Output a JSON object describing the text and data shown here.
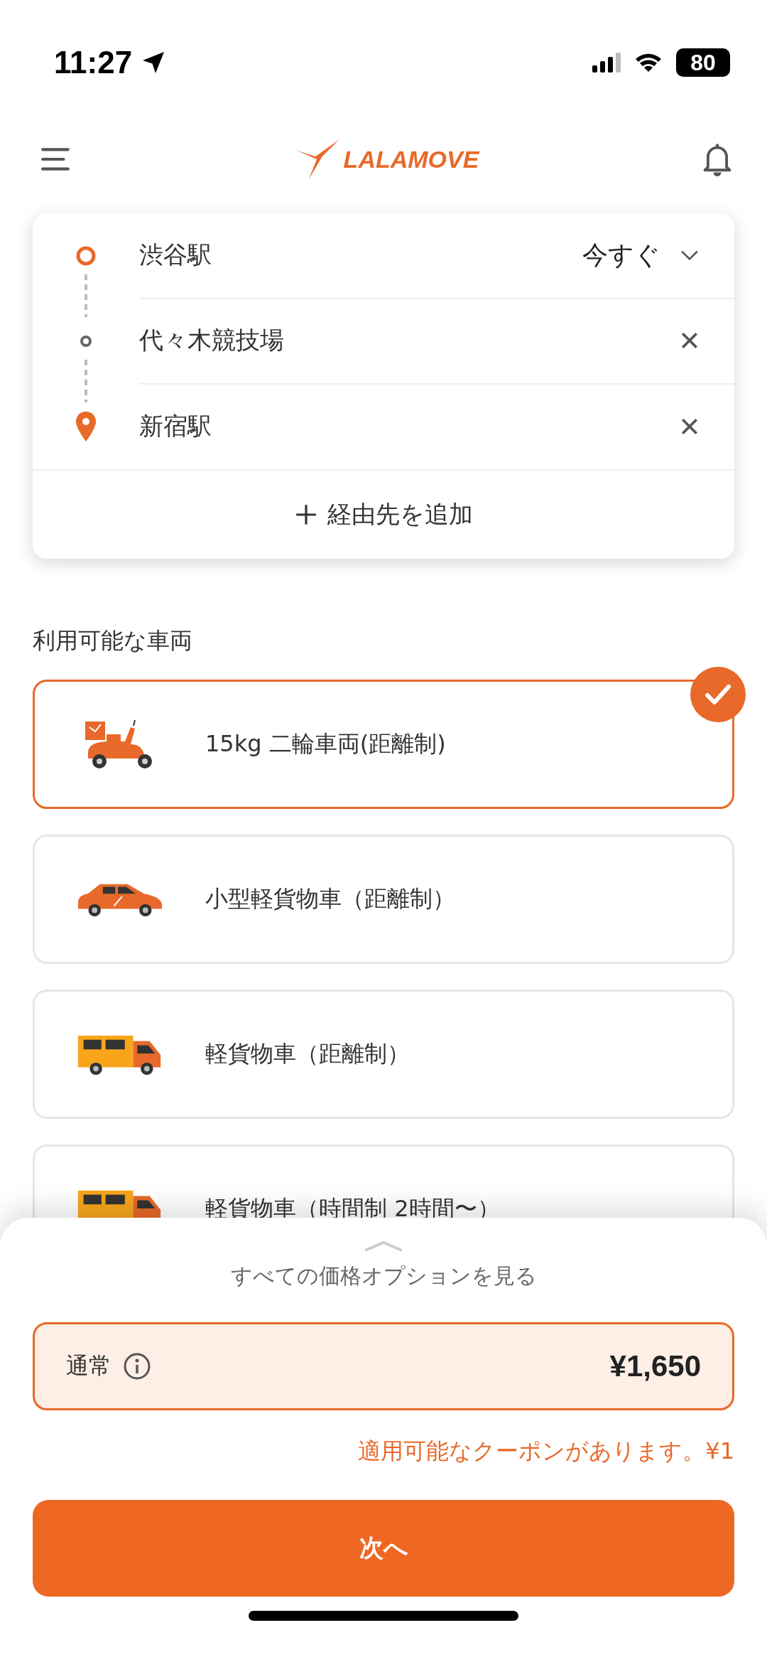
{
  "status_bar": {
    "time": "11:27",
    "battery": "80"
  },
  "header": {
    "logo": "LALAMOVE"
  },
  "route": {
    "time_option": "今すぐ",
    "add_stop": "経由先を追加",
    "stops": [
      {
        "kind": "pickup",
        "name": "渋谷駅",
        "removable": false
      },
      {
        "kind": "waypoint",
        "name": "代々木競技場",
        "removable": true
      },
      {
        "kind": "dropoff",
        "name": "新宿駅",
        "removable": true
      }
    ]
  },
  "vehicles": {
    "title": "利用可能な車両",
    "items": [
      {
        "kind": "scooter",
        "label": "15kg 二輪車両(距離制)",
        "selected": true
      },
      {
        "kind": "car",
        "label": "小型軽貨物車（距離制）",
        "selected": false
      },
      {
        "kind": "van",
        "label": "軽貨物車（距離制）",
        "selected": false
      },
      {
        "kind": "van",
        "label": "軽貨物車（時間制 2時間〜）",
        "selected": false
      }
    ]
  },
  "price_sheet": {
    "expand_label": "すべての価格オプションを見る",
    "option": {
      "name": "通常",
      "price": "¥1,650"
    },
    "coupon": "適用可能なクーポンがあります。¥1",
    "next_button": "次へ"
  }
}
